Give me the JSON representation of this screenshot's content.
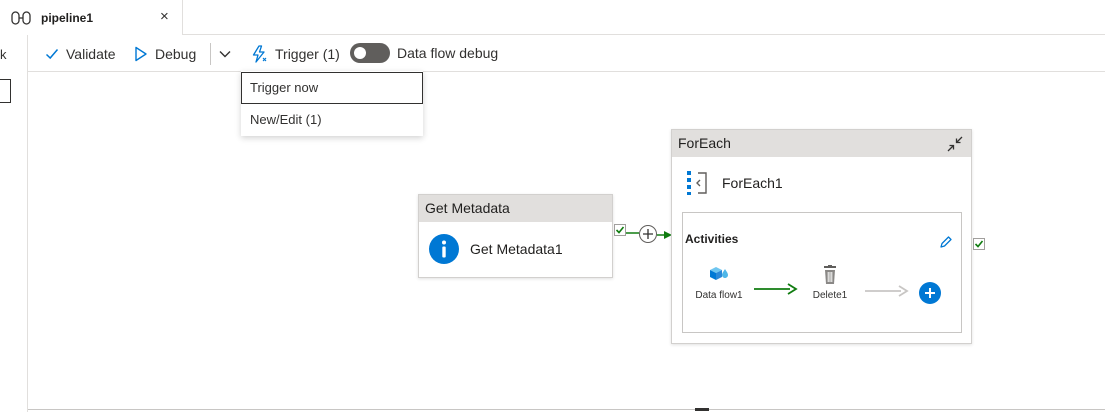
{
  "tab": {
    "title": "pipeline1",
    "close_glyph": "×",
    "icon": "pipeline-icon"
  },
  "left_panel": {
    "glyph": "k"
  },
  "toolbar": {
    "validate_label": "Validate",
    "debug_label": "Debug",
    "trigger_label": "Trigger (1)",
    "dataflow_debug_label": "Data flow debug",
    "dataflow_debug_enabled": false
  },
  "trigger_menu": {
    "items": [
      {
        "label": "Trigger now"
      },
      {
        "label": "New/Edit (1)"
      }
    ]
  },
  "canvas": {
    "get_metadata": {
      "type_label": "Get Metadata",
      "name": "Get Metadata1",
      "icon": "info-icon"
    },
    "foreach": {
      "type_label": "ForEach",
      "name": "ForEach1",
      "icon": "foreach-icon",
      "activities_label": "Activities",
      "inner_activities": [
        {
          "name": "Data flow1",
          "icon": "data-flow-icon"
        },
        {
          "name": "Delete1",
          "icon": "trash-icon"
        }
      ]
    }
  },
  "colors": {
    "accent": "#0078d4",
    "success_arrow": "#107c10",
    "inactive_arrow": "#c8c6c4",
    "header_bg": "#e1dfdd"
  }
}
